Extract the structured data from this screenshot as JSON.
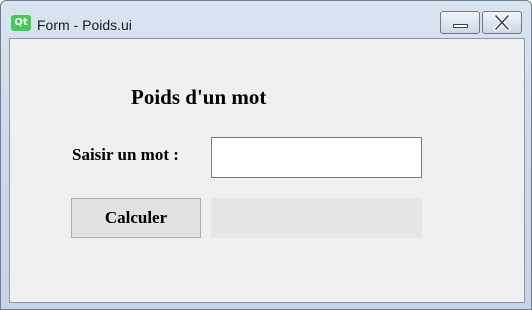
{
  "window": {
    "title": "Form - Poids.ui",
    "app_icon_text": "Qt",
    "icon": "qt-logo-icon"
  },
  "controls": {
    "minimize_icon": "minimize-icon",
    "close_icon": "close-icon"
  },
  "form": {
    "heading": "Poids d'un mot",
    "prompt_label": "Saisir un mot :",
    "word_input_value": "",
    "calculate_button": "Calculer",
    "result_value": ""
  },
  "colors": {
    "qt_green": "#41cd52",
    "client_bg": "#f0f0f0"
  }
}
